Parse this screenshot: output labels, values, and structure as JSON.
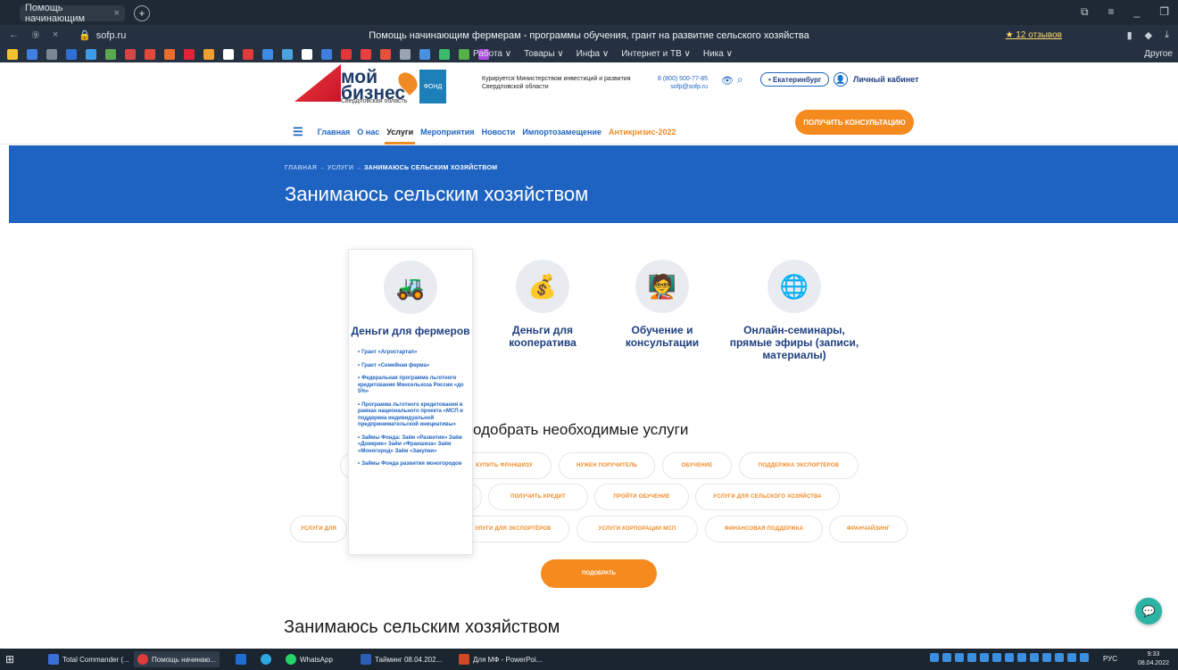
{
  "browser": {
    "tab_title": "Помощь начинающим",
    "tab_close": "×",
    "new_tab": "+",
    "url": "sofp.ru",
    "page_title": "Помощь начинающим фермерам - программы обучения, грант на развитие сельского хозяйства",
    "reviews": "★ 12 отзывов",
    "bookmark_menus": [
      "Работа ∨",
      "Товары ∨",
      "Инфа ∨",
      "Интернет и ТВ ∨",
      "Ника ∨"
    ],
    "bookmark_other": "Другое"
  },
  "header": {
    "logo_line1": "мой",
    "logo_line2": "бизнес",
    "logo_region": "Свердловская область",
    "logo_fond": "ФОНД",
    "curated": "Курируется Министерством инвестиций и развития Свердловской области",
    "phone": "8 (800) 500-77-85",
    "email": "sofp@sofp.ru",
    "city": "• Екатеринбург",
    "cabinet": "Личный кабинет",
    "menu": [
      "Главная",
      "О нас",
      "Услуги",
      "Мероприятия",
      "Новости",
      "Импортозамещение"
    ],
    "menu_crisis": "Антикризис-2022",
    "consult_button": "ПОЛУЧИТЬ КОНСУЛЬТАЦИЮ"
  },
  "hero": {
    "breadcrumb_home": "ГЛАВНАЯ",
    "breadcrumb_services": "УСЛУГИ",
    "breadcrumb_current": "ЗАНИМАЮСЬ СЕЛЬСКИМ ХОЗЯЙСТВОМ",
    "title": "Занимаюсь сельским хозяйством"
  },
  "cards": [
    {
      "title": "Деньги для фермеров",
      "icon": "tractor-icon",
      "glyph": "🚜"
    },
    {
      "title": "Деньги для кооператива",
      "icon": "money-bag-icon",
      "glyph": "💰"
    },
    {
      "title": "Обучение и консультации",
      "icon": "teacher-icon",
      "glyph": "🧑‍🏫"
    },
    {
      "title": "Онлайн-семинары, прямые эфиры (записи, материалы)",
      "icon": "webinar-icon",
      "glyph": "🌐"
    }
  ],
  "sub_items": [
    "Грант «Агростартап»",
    "Грант «Семейная ферма»",
    "Федеральная программа льготного кредитования Минсельхоза России «до 5%»",
    "Программа льготного кредитования в рамках национального проекта «МСП и поддержка индивидуальной предпринимательской инициативы»",
    "Займы Фонда: Заём «Развитие» Заём «Доверие» Заём «Франшиза» Заём «Моногород» Заём «Закупки»",
    "Займы Фонда развития моногородов"
  ],
  "selector": {
    "title": "одобрать необходимые услуги",
    "chips_row1": [
      "КУПИТЬ ФРАНШИЗУ",
      "НУЖЕН ПОРУЧИТЕЛЬ",
      "ОБУЧЕНИЕ",
      "ПОДДЕРЖКА ЭКСПОРТЁРОВ"
    ],
    "chips_row2": [
      "ПОЛУЧИТЬ КРЕДИТ",
      "ПРОЙТИ ОБУЧЕНИЕ",
      "УСЛУГИ ДЛЯ СЕЛЬСКОГО ХОЗЯЙСТВА"
    ],
    "chips_row3": [
      "УСЛУГИ ДЛЯ",
      "УЛУГИ ДЛЯ ЭКСПОРТЁРОВ",
      "УСЛУГИ КОРПОРАЦИИ МСП",
      "ФИНАНСОВАЯ ПОДДЕРЖКА",
      "ФРАНЧАЙЗИНГ"
    ],
    "pick_button": "ПОДОБРАТЬ"
  },
  "section_title": "Занимаюсь сельским хозяйством",
  "taskbar": {
    "items": [
      "Total Commander (...",
      "Помощь начинаю...",
      "",
      "",
      "WhatsApp",
      "Тайминг 08.04.202...",
      "Для МФ - PowerPoi..."
    ],
    "lang": "РУС",
    "time": "9:33",
    "date": "08.04.2022"
  }
}
